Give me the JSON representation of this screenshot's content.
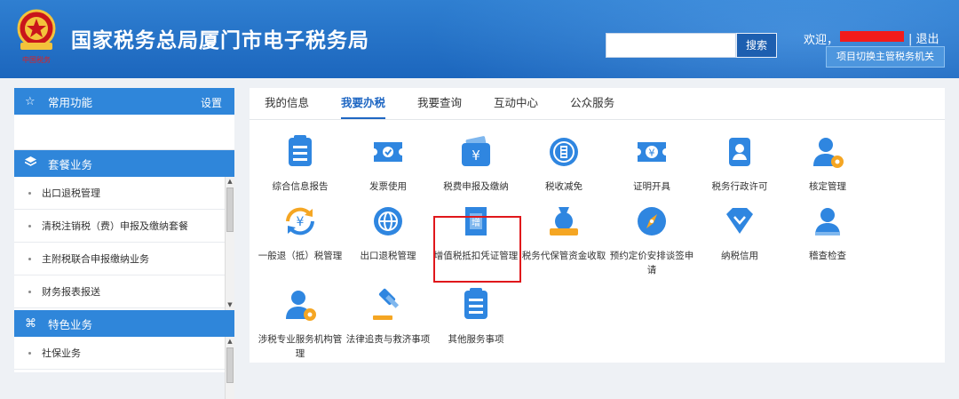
{
  "header": {
    "title": "国家税务总局厦门市电子税务局",
    "search_placeholder": "",
    "search_button": "搜索",
    "welcome": "欢迎，",
    "logout": "| 退出",
    "switch_button": "项目切换主管税务机关"
  },
  "sidebar": {
    "common": {
      "title": "常用功能",
      "setting": "设置",
      "icon": "star-icon"
    },
    "package": {
      "title": "套餐业务",
      "icon": "layers-icon",
      "items": [
        "出口退税管理",
        "清税注销税（费）申报及缴纳套餐",
        "主附税联合申报缴纳业务",
        "财务报表报送"
      ]
    },
    "special": {
      "title": "特色业务",
      "icon": "command-icon",
      "items": [
        "社保业务"
      ]
    }
  },
  "tabs": [
    {
      "label": "我的信息",
      "active": false
    },
    {
      "label": "我要办税",
      "active": true
    },
    {
      "label": "我要查询",
      "active": false
    },
    {
      "label": "互动中心",
      "active": false
    },
    {
      "label": "公众服务",
      "active": false
    }
  ],
  "services": [
    {
      "label": "综合信息报告",
      "icon": "document-icon"
    },
    {
      "label": "发票使用",
      "icon": "ticket-check-icon"
    },
    {
      "label": "税费申报及缴纳",
      "icon": "wallet-yuan-icon",
      "highlighted": true
    },
    {
      "label": "税收减免",
      "icon": "coin-icon"
    },
    {
      "label": "证明开具",
      "icon": "ticket-yuan-icon"
    },
    {
      "label": "税务行政许可",
      "icon": "id-badge-icon"
    },
    {
      "label": "核定管理",
      "icon": "user-gear-icon"
    },
    {
      "label": "一般退（抵）税管理",
      "icon": "refresh-yuan-icon"
    },
    {
      "label": "出口退税管理",
      "icon": "globe-icon"
    },
    {
      "label": "增值税抵扣凭证管理",
      "icon": "invoice-icon"
    },
    {
      "label": "税务代保管资金收取",
      "icon": "money-bag-icon"
    },
    {
      "label": "预约定价安排谈签申请",
      "icon": "compass-icon"
    },
    {
      "label": "纳税信用",
      "icon": "diamond-icon"
    },
    {
      "label": "稽查检查",
      "icon": "user-icon"
    },
    {
      "label": "涉税专业服务机构管理",
      "icon": "user-gear-icon"
    },
    {
      "label": "法律追责与救济事项",
      "icon": "gavel-icon"
    },
    {
      "label": "其他服务事项",
      "icon": "document-icon"
    }
  ],
  "colors": {
    "header_blue": "#1c66bd",
    "accent": "#1f67c3",
    "sidebar_head": "#2f86da",
    "highlight_red": "#e0171b",
    "redaction": "#f21b1b"
  }
}
